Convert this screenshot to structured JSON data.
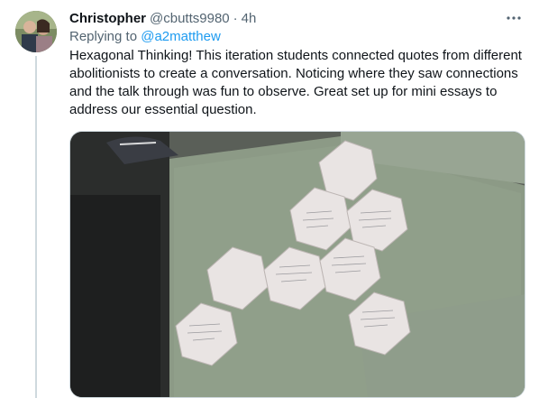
{
  "tweet": {
    "author_name": "Christopher",
    "author_handle": "@cbutts9980",
    "separator": "·",
    "timestamp": "4h",
    "more_icon": "more-horizontal-icon",
    "reply_prefix": "Replying to",
    "reply_handle": "@a2matthew",
    "text": "Hexagonal Thinking! This iteration students connected quotes from different abolitionists to create a conversation. Noticing where they saw connections and the talk through was fun to observe. Great set up for mini essays to address our essential question."
  },
  "colors": {
    "link": "#1d9bf0",
    "secondary_text": "#536471",
    "thread_line": "#cfd9de"
  }
}
